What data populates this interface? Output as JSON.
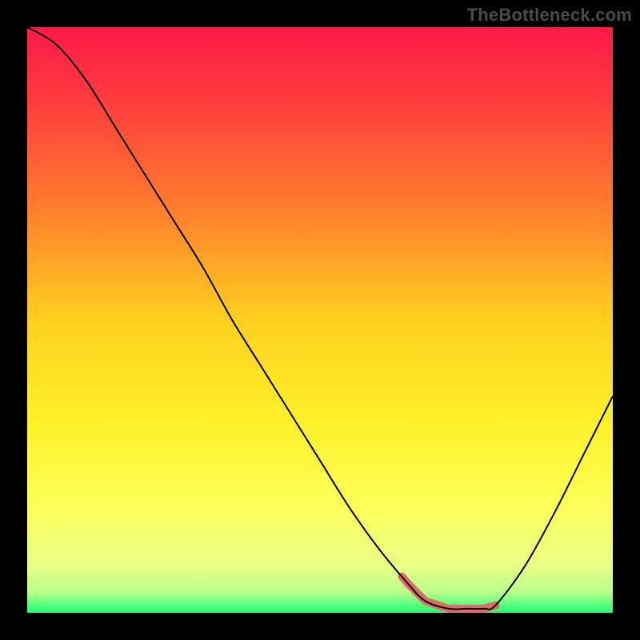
{
  "watermark": "TheBottleneck.com",
  "chart_data": {
    "type": "line",
    "title": "",
    "xlabel": "",
    "ylabel": "",
    "xlim": [
      0,
      100
    ],
    "ylim": [
      0,
      100
    ],
    "grid": false,
    "x": [
      0,
      5,
      10,
      15,
      20,
      25,
      30,
      35,
      40,
      45,
      50,
      55,
      60,
      65,
      68,
      72,
      75,
      78,
      80,
      85,
      90,
      95,
      100
    ],
    "values": [
      100,
      97,
      91,
      83,
      75,
      67,
      59,
      50,
      42,
      34,
      26,
      18,
      11,
      5,
      2,
      0.7,
      0.7,
      0.7,
      1.3,
      8,
      17,
      27,
      37
    ],
    "background_gradient_stops": [
      {
        "pos": 0.0,
        "color": "#ff1a47"
      },
      {
        "pos": 0.12,
        "color": "#ff3a3f"
      },
      {
        "pos": 0.3,
        "color": "#ff7a2e"
      },
      {
        "pos": 0.5,
        "color": "#ffd01e"
      },
      {
        "pos": 0.68,
        "color": "#fff22a"
      },
      {
        "pos": 0.82,
        "color": "#fdff5a"
      },
      {
        "pos": 0.92,
        "color": "#e8ff86"
      },
      {
        "pos": 0.965,
        "color": "#b8ff8a"
      },
      {
        "pos": 0.985,
        "color": "#5cff7f"
      },
      {
        "pos": 1.0,
        "color": "#1aff6e"
      }
    ],
    "highlight_segment": {
      "color": "#e26a6a",
      "x_range": [
        64,
        80
      ],
      "stroke_width": 10
    },
    "curve_stroke": "#000000",
    "curve_stroke_width": 2
  }
}
